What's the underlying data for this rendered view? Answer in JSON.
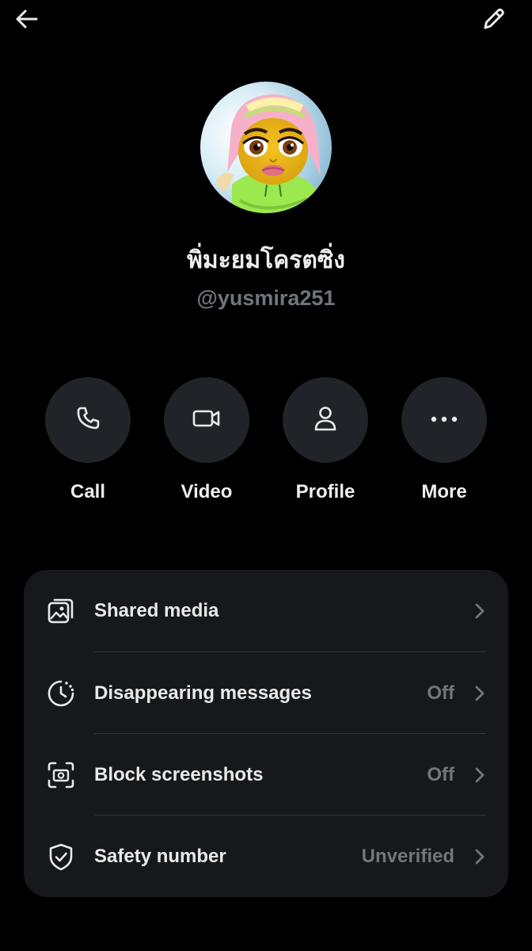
{
  "header": {
    "back_icon": "arrow-left-icon",
    "edit_icon": "pencil-icon"
  },
  "profile": {
    "display_name": "พิ่มะยมโครตซิ่ง",
    "handle": "@yusmira251",
    "avatar": "cartoon-avatar"
  },
  "actions": [
    {
      "label": "Call",
      "icon": "phone-icon"
    },
    {
      "label": "Video",
      "icon": "video-camera-icon"
    },
    {
      "label": "Profile",
      "icon": "person-icon"
    },
    {
      "label": "More",
      "icon": "more-horizontal-icon"
    }
  ],
  "settings": [
    {
      "label": "Shared media",
      "value": "",
      "icon": "image-stack-icon"
    },
    {
      "label": "Disappearing messages",
      "value": "Off",
      "icon": "timer-icon"
    },
    {
      "label": "Block screenshots",
      "value": "Off",
      "icon": "screenshot-icon"
    },
    {
      "label": "Safety number",
      "value": "Unverified",
      "icon": "shield-check-icon"
    }
  ],
  "colors": {
    "background": "#000000",
    "card": "#16181c",
    "action_circle": "#202327",
    "primary_text": "#e7e9ea",
    "secondary_text": "#71767b"
  }
}
